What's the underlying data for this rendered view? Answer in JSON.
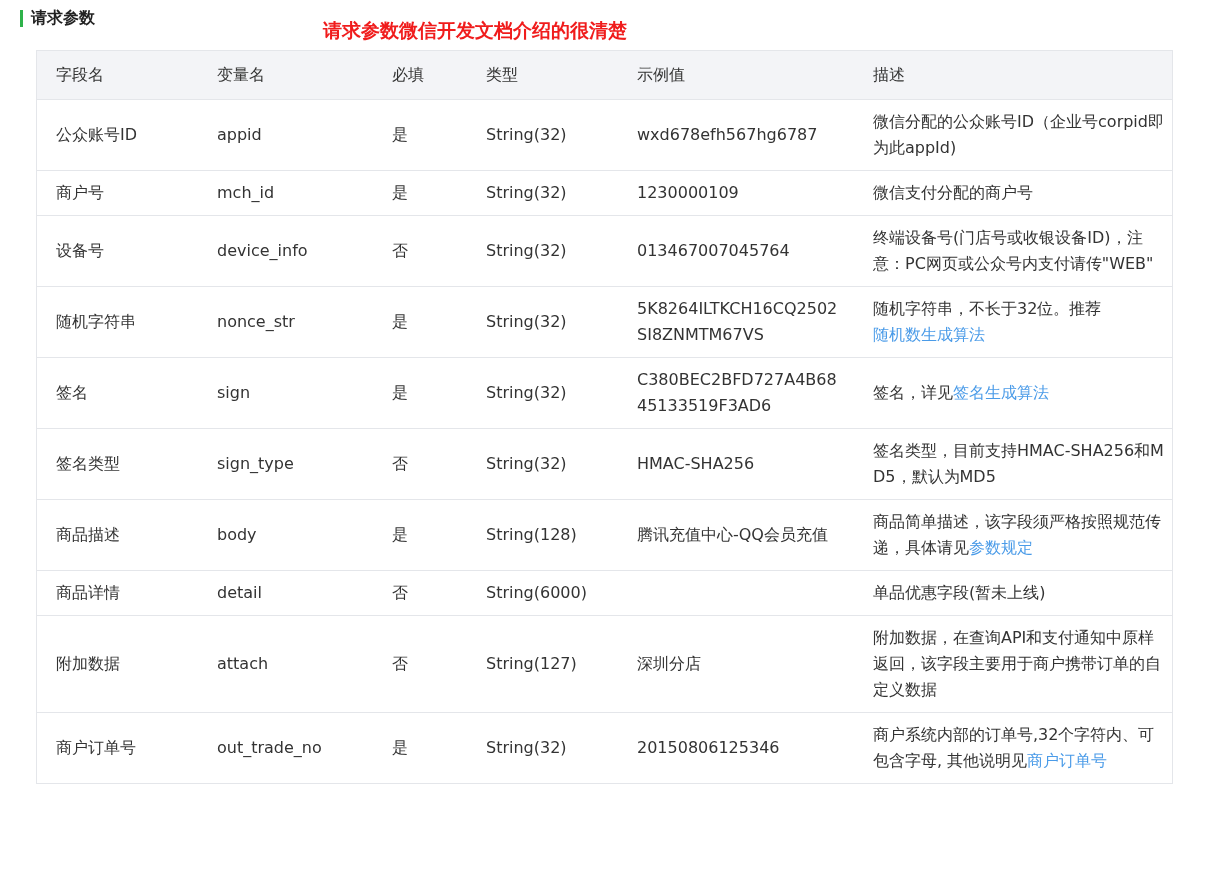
{
  "section_title": "请求参数",
  "annotation": "请求参数微信开发文档介绍的很清楚",
  "table": {
    "columns": [
      "字段名",
      "变量名",
      "必填",
      "类型",
      "示例值",
      "描述"
    ],
    "rows": [
      {
        "field": "公众账号ID",
        "variable": "appid",
        "required": "是",
        "type": "String(32)",
        "example": "wxd678efh567hg6787",
        "description": [
          {
            "kind": "text",
            "text": "微信分配的公众账号ID（企业号corpid即为此appId)"
          }
        ]
      },
      {
        "field": "商户号",
        "variable": "mch_id",
        "required": "是",
        "type": "String(32)",
        "example": "1230000109",
        "description": [
          {
            "kind": "text",
            "text": "微信支付分配的商户号"
          }
        ]
      },
      {
        "field": "设备号",
        "variable": "device_info",
        "required": "否",
        "type": "String(32)",
        "example": "013467007045764",
        "description": [
          {
            "kind": "text",
            "text": "终端设备号(门店号或收银设备ID)，注意：PC网页或公众号内支付请传\"WEB\""
          }
        ]
      },
      {
        "field": "随机字符串",
        "variable": "nonce_str",
        "required": "是",
        "type": "String(32)",
        "example": "5K8264ILTKCH16CQ2502SI8ZNMTM67VS",
        "description": [
          {
            "kind": "text",
            "text": "随机字符串，不长于32位。推荐"
          },
          {
            "kind": "link",
            "text": "随机数生成算法"
          }
        ]
      },
      {
        "field": "签名",
        "variable": "sign",
        "required": "是",
        "type": "String(32)",
        "example": "C380BEC2BFD727A4B6845133519F3AD6",
        "description": [
          {
            "kind": "text",
            "text": "签名，详见"
          },
          {
            "kind": "link",
            "text": "签名生成算法"
          }
        ]
      },
      {
        "field": "签名类型",
        "variable": "sign_type",
        "required": "否",
        "type": "String(32)",
        "example": "HMAC-SHA256",
        "description": [
          {
            "kind": "text",
            "text": "签名类型，目前支持HMAC-SHA256和MD5，默认为MD5"
          }
        ]
      },
      {
        "field": "商品描述",
        "variable": "body",
        "required": "是",
        "type": "String(128)",
        "example": "腾讯充值中心-QQ会员充值",
        "description": [
          {
            "kind": "text",
            "text": "商品简单描述，该字段须严格按照规范传递，具体请见"
          },
          {
            "kind": "link",
            "text": "参数规定"
          }
        ]
      },
      {
        "field": "商品详情",
        "variable": "detail",
        "required": "否",
        "type": "String(6000)",
        "description": [
          {
            "kind": "text",
            "text": "单品优惠字段(暂未上线)"
          }
        ]
      },
      {
        "field": "附加数据",
        "variable": "attach",
        "required": "否",
        "type": "String(127)",
        "example": "深圳分店",
        "description": [
          {
            "kind": "text",
            "text": "附加数据，在查询API和支付通知中原样返回，该字段主要用于商户携带订单的自定义数据"
          }
        ]
      },
      {
        "field": "商户订单号",
        "variable": "out_trade_no",
        "required": "是",
        "type": "String(32)",
        "example": "20150806125346",
        "description": [
          {
            "kind": "text",
            "text": "商户系统内部的订单号,32个字符内、可包含字母, 其他说明见"
          },
          {
            "kind": "link",
            "text": "商户订单号"
          }
        ]
      }
    ]
  }
}
